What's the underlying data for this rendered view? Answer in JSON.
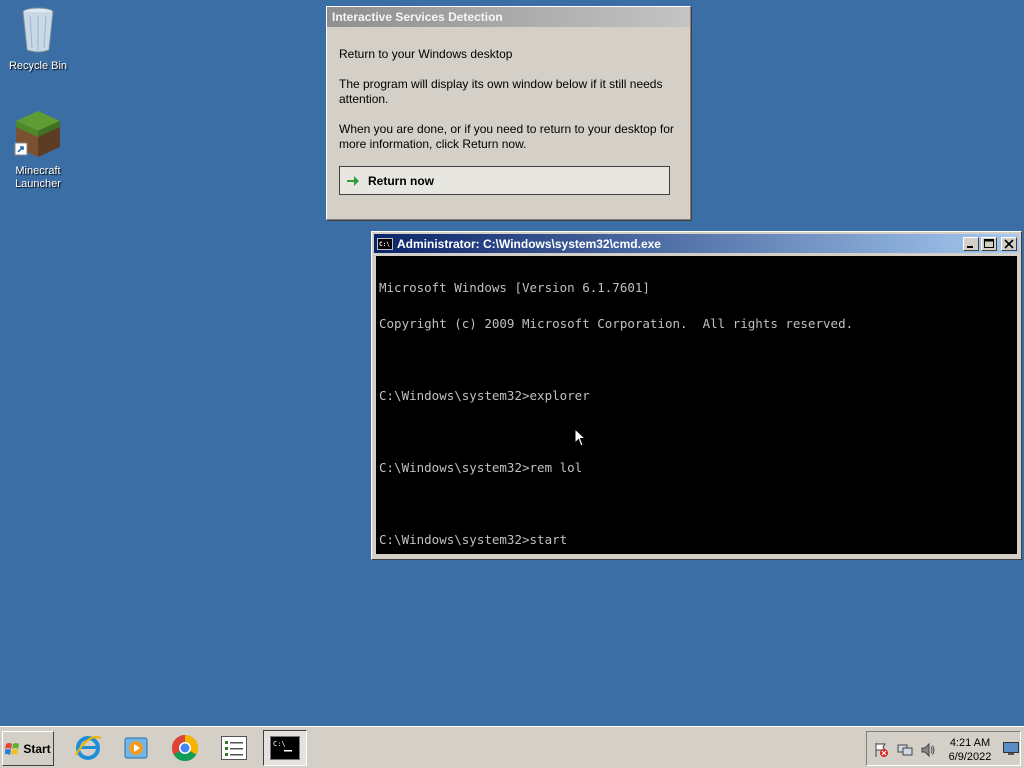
{
  "desktop": {
    "icons": [
      {
        "label": "Recycle Bin"
      },
      {
        "label": "Minecraft\nLauncher"
      }
    ]
  },
  "dialog": {
    "title": "Interactive Services Detection",
    "heading": "Return to your Windows desktop",
    "paragraph1": "The program will display its own window below if it still needs attention.",
    "paragraph2": "When you are done, or if you need to return to your desktop for more information, click Return now.",
    "button_label": "Return now"
  },
  "cmd": {
    "title": "Administrator: C:\\Windows\\system32\\cmd.exe",
    "lines": [
      "Microsoft Windows [Version 6.1.7601]",
      "Copyright (c) 2009 Microsoft Corporation.  All rights reserved.",
      "",
      "C:\\Windows\\system32>explorer",
      "",
      "C:\\Windows\\system32>rem lol",
      "",
      "C:\\Windows\\system32>start"
    ]
  },
  "taskbar": {
    "start_label": "Start",
    "apps": [
      "ie-icon",
      "media-player-icon",
      "chrome-icon",
      "task-list-icon",
      "cmd-icon"
    ],
    "clock_time": "4:21 AM",
    "clock_date": "6/9/2022"
  },
  "colors": {
    "desktop": "#3a6ea5",
    "cmd_titlebar": "#0a246a",
    "dialog_bg": "#d4d0c8"
  }
}
